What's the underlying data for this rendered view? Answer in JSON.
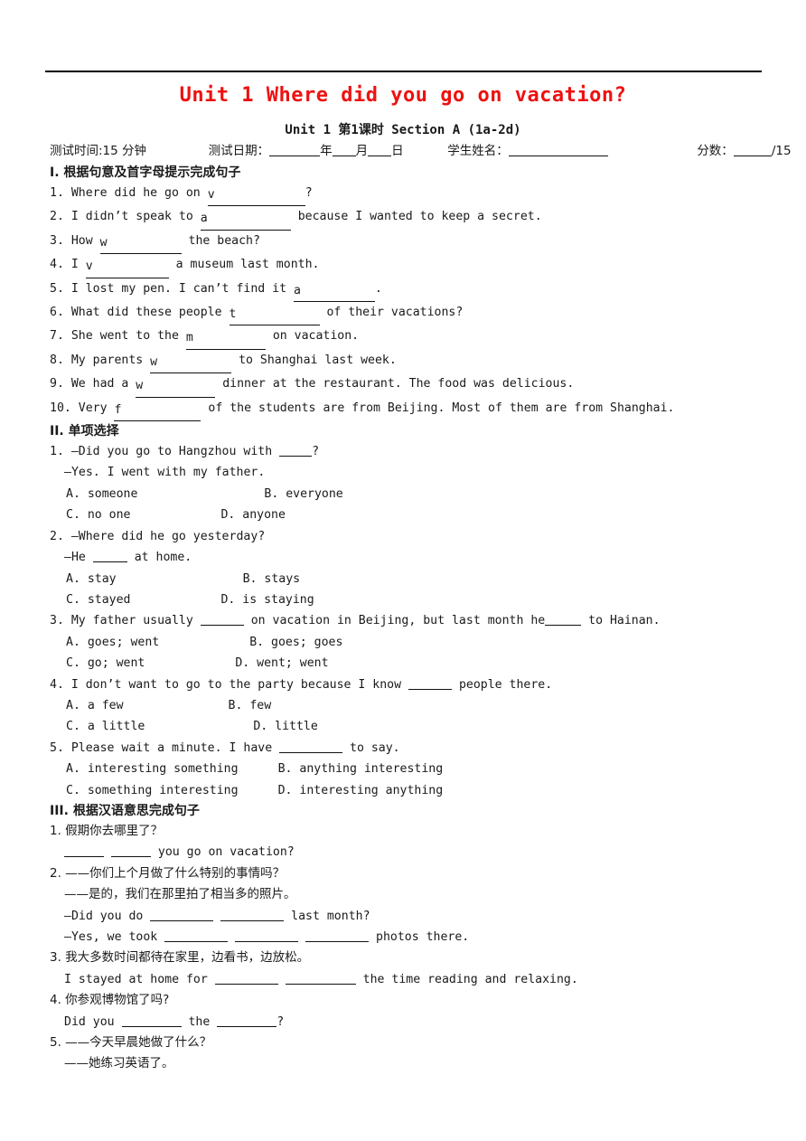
{
  "document": {
    "title": "Unit 1 Where did you go on vacation?",
    "subtitle": "Unit 1 第1课时 Section A (1a-2d)",
    "title_color": "#ee1111"
  },
  "meta": {
    "test_time_label": "测试时间:15 分钟",
    "test_date_label": "测试日期：",
    "year": "年",
    "month": "月",
    "day": "日",
    "student_name_label": "学生姓名：",
    "score_label": "分数：",
    "score_total": "/15"
  },
  "sections": [
    {
      "heading": "I.  根据句意及首字母提示完成句子",
      "items": [
        {
          "num": "1.",
          "pre": "Where did he go on ",
          "hint": "v",
          "blank_w": 108,
          "post": "?"
        },
        {
          "num": "2.",
          "pre": "I didn’t speak to ",
          "hint": "a",
          "blank_w": 100,
          "post": " because I wanted to keep a secret."
        },
        {
          "num": "3.",
          "pre": "How ",
          "hint": "w",
          "blank_w": 90,
          "post": " the beach?"
        },
        {
          "num": "4.",
          "pre": "I ",
          "hint": "v",
          "blank_w": 92,
          "post": " a museum last month."
        },
        {
          "num": "5.",
          "pre": "I lost my pen. I can’t find it ",
          "hint": "a",
          "blank_w": 90,
          "post": "."
        },
        {
          "num": "6.",
          "pre": "What did these people ",
          "hint": "t",
          "blank_w": 100,
          "post": " of their vacations?"
        },
        {
          "num": "7.",
          "pre": "She went to the ",
          "hint": "m",
          "blank_w": 88,
          "post": " on vacation."
        },
        {
          "num": "8.",
          "pre": "My parents ",
          "hint": "w",
          "blank_w": 90,
          "post": " to Shanghai last week."
        },
        {
          "num": "9.",
          "pre": "We had a ",
          "hint": "w",
          "blank_w": 88,
          "post": " dinner at the restaurant. The food was delicious."
        },
        {
          "num": "10.",
          "pre": "Very ",
          "hint": "f",
          "blank_w": 96,
          "post": " of the students are from Beijing. Most of them are from Shanghai."
        }
      ]
    },
    {
      "heading": "II.  单项选择",
      "questions": [
        {
          "num": "1.",
          "stem_pre": "—Did you go to Hangzhou with ",
          "stem_blank_w": 36,
          "stem_post": "?",
          "reply": "—Yes. I went with my father.",
          "options": [
            {
              "key": "A.",
              "text": "someone",
              "key2": "B.",
              "text2": "everyone",
              "gap": 140
            },
            {
              "key": "C.",
              "text": "no one",
              "key2": "D.",
              "text2": "anyone",
              "gap": 100
            }
          ]
        },
        {
          "num": "2.",
          "stem_pre": "—Where did he go yesterday?",
          "stem_blank_w": 0,
          "stem_post": "",
          "reply": "—He ___ at home.",
          "reply_pre": "—He ",
          "reply_blank_w": 38,
          "reply_post": " at home.",
          "options": [
            {
              "key": "A.",
              "text": "stay",
              "key2": "B.",
              "text2": "stays",
              "gap": 140
            },
            {
              "key": "C.",
              "text": "stayed",
              "key2": "D.",
              "text2": "is staying",
              "gap": 100
            }
          ]
        },
        {
          "num": "3.",
          "stem_pre": "My father usually ",
          "stem_blank_w": 48,
          "stem_mid": " on vacation in Beijing, but last month he",
          "stem_blank2_w": 40,
          "stem_post": " to Hainan.",
          "options": [
            {
              "key": "A.",
              "text": "goes; went",
              "key2": "B.",
              "text2": "goes; goes",
              "gap": 100
            },
            {
              "key": "C.",
              "text": "go; went",
              "key2": "D.",
              "text2": "went; went",
              "gap": 100
            }
          ]
        },
        {
          "num": "4.",
          "stem_pre": "I don’t want to go to the party because I know ",
          "stem_blank_w": 48,
          "stem_post": " people there.",
          "options": [
            {
              "key": "A.",
              "text": "a few",
              "key2": "B.",
              "text2": "few",
              "gap": 116
            },
            {
              "key": "C.",
              "text": "a little",
              "key2": "D.",
              "text2": "little",
              "gap": 120
            }
          ]
        },
        {
          "num": "5.",
          "stem_pre": "Please wait a minute. I have ",
          "stem_blank_w": 70,
          "stem_post": " to say.",
          "options": [
            {
              "key": "A.",
              "text": "interesting something",
              "key2": "B.",
              "text2": "anything interesting",
              "gap": 44
            },
            {
              "key": "C.",
              "text": "something interesting",
              "key2": "D.",
              "text2": "interesting anything",
              "gap": 44
            }
          ]
        }
      ]
    },
    {
      "heading": "III.  根据汉语意思完成句子",
      "items": [
        {
          "num": "1.",
          "zh": [
            "假期你去哪里了？"
          ],
          "en": [
            {
              "pre": " ",
              "blanks": [
                44,
                44
              ],
              "mids": [
                " "
              ],
              "post": " you go on vacation?"
            }
          ]
        },
        {
          "num": "2.",
          "zh": [
            "——你们上个月做了什么特别的事情吗？",
            "——是的，我们在那里拍了相当多的照片。"
          ],
          "en": [
            {
              "pre": "—Did you do ",
              "blanks": [
                70,
                70
              ],
              "mids": [
                " "
              ],
              "post": " last month?"
            },
            {
              "pre": "—Yes, we took ",
              "blanks": [
                70,
                70,
                70
              ],
              "mids": [
                " ",
                " "
              ],
              "post": " photos there."
            }
          ]
        },
        {
          "num": "3.",
          "zh": [
            "我大多数时间都待在家里，边看书，边放松。"
          ],
          "en": [
            {
              "pre": "I stayed at home for ",
              "blanks": [
                70,
                78
              ],
              "mids": [
                " "
              ],
              "post": " the time reading and relaxing."
            }
          ]
        },
        {
          "num": "4.",
          "zh": [
            "你参观博物馆了吗?"
          ],
          "en": [
            {
              "pre": "Did you ",
              "blanks": [
                66,
                66
              ],
              "mids": [
                " the "
              ],
              "post": "?"
            }
          ]
        },
        {
          "num": "5.",
          "zh": [
            "——今天早晨她做了什么？",
            "——她练习英语了。"
          ],
          "en": []
        }
      ]
    }
  ]
}
